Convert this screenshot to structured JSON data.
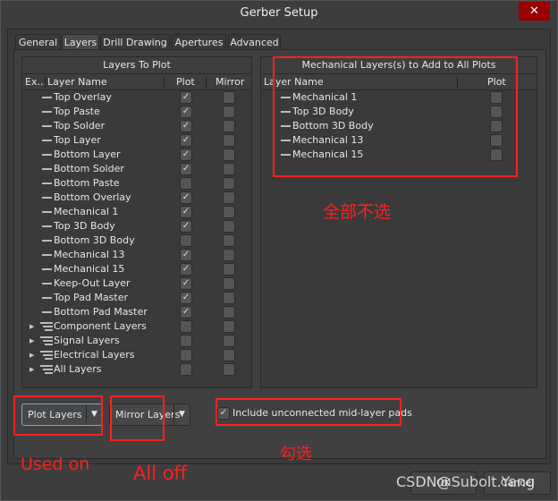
{
  "window": {
    "title": "Gerber Setup",
    "close": "✕"
  },
  "tabs": [
    "General",
    "Layers",
    "Drill Drawing",
    "Apertures",
    "Advanced"
  ],
  "left_panel": {
    "title": "Layers To Plot",
    "columns": [
      "Ex...",
      "Layer Name",
      "Plot",
      "Mirror"
    ],
    "rows": [
      {
        "name": "Top Overlay",
        "plot": true,
        "mirror": false,
        "group": false
      },
      {
        "name": "Top Paste",
        "plot": true,
        "mirror": false,
        "group": false
      },
      {
        "name": "Top Solder",
        "plot": true,
        "mirror": false,
        "group": false
      },
      {
        "name": "Top Layer",
        "plot": true,
        "mirror": false,
        "group": false
      },
      {
        "name": "Bottom Layer",
        "plot": true,
        "mirror": false,
        "group": false
      },
      {
        "name": "Bottom Solder",
        "plot": true,
        "mirror": false,
        "group": false
      },
      {
        "name": "Bottom Paste",
        "plot": false,
        "mirror": false,
        "group": false
      },
      {
        "name": "Bottom Overlay",
        "plot": true,
        "mirror": false,
        "group": false
      },
      {
        "name": "Mechanical 1",
        "plot": true,
        "mirror": false,
        "group": false
      },
      {
        "name": "Top 3D Body",
        "plot": true,
        "mirror": false,
        "group": false
      },
      {
        "name": "Bottom 3D Body",
        "plot": false,
        "mirror": false,
        "group": false
      },
      {
        "name": "Mechanical 13",
        "plot": true,
        "mirror": false,
        "group": false
      },
      {
        "name": "Mechanical 15",
        "plot": true,
        "mirror": false,
        "group": false
      },
      {
        "name": "Keep-Out Layer",
        "plot": true,
        "mirror": false,
        "group": false
      },
      {
        "name": "Top Pad Master",
        "plot": true,
        "mirror": false,
        "group": false
      },
      {
        "name": "Bottom Pad Master",
        "plot": true,
        "mirror": false,
        "group": false
      },
      {
        "name": "Component Layers",
        "plot": false,
        "mirror": false,
        "group": true
      },
      {
        "name": "Signal Layers",
        "plot": false,
        "mirror": false,
        "group": true
      },
      {
        "name": "Electrical Layers",
        "plot": false,
        "mirror": false,
        "group": true
      },
      {
        "name": "All Layers",
        "plot": false,
        "mirror": false,
        "group": true
      }
    ]
  },
  "right_panel": {
    "title": "Mechanical Layers(s) to Add to All Plots",
    "columns": [
      "Layer Name",
      "Plot"
    ],
    "rows": [
      {
        "name": "Mechanical 1",
        "plot": false
      },
      {
        "name": "Top 3D Body",
        "plot": false
      },
      {
        "name": "Bottom 3D Body",
        "plot": false
      },
      {
        "name": "Mechanical 13",
        "plot": false
      },
      {
        "name": "Mechanical 15",
        "plot": false
      }
    ]
  },
  "controls": {
    "plot_layers": "Plot Layers",
    "mirror_layers": "Mirror Layers",
    "include_pads": "Include unconnected mid-layer pads",
    "include_pads_checked": true
  },
  "buttons": {
    "ok": "OK",
    "cancel": "Cancel"
  },
  "annotations": {
    "right": "全部不选",
    "plot": "Used on",
    "mirror": "All off",
    "include": "勾选",
    "color": "#ff2020"
  },
  "watermark": "CSDN@Subolt.Yang"
}
